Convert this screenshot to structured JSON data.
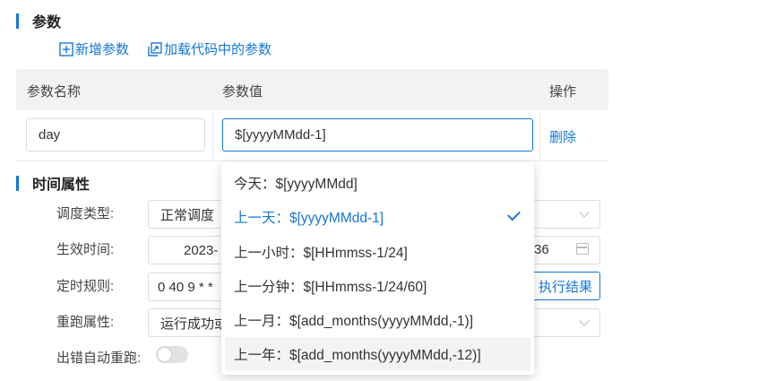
{
  "params_section": {
    "title": "参数",
    "add_param_label": "新增参数",
    "load_params_label": "加载代码中的参数"
  },
  "params_table": {
    "headers": [
      "参数名称",
      "参数值",
      "操作"
    ],
    "rows": [
      {
        "name": "day",
        "value": "$[yyyyMMdd-1]",
        "action": "删除"
      }
    ]
  },
  "dropdown": {
    "options": [
      {
        "label": "今天：$[yyyyMMdd]",
        "selected": false
      },
      {
        "label": "上一天：$[yyyyMMdd-1]",
        "selected": true
      },
      {
        "label": "上一小时：$[HHmmss-1/24]",
        "selected": false
      },
      {
        "label": "上一分钟：$[HHmmss-1/24/60]",
        "selected": false
      },
      {
        "label": "上一月：$[add_months(yyyyMMdd,-1)]",
        "selected": false
      },
      {
        "label": "上一年：$[add_months(yyyyMMdd,-12)]",
        "selected": false,
        "hovered": true
      }
    ]
  },
  "time_section": {
    "title": "时间属性",
    "schedule_type": {
      "label": "调度类型:",
      "value": "正常调度"
    },
    "effective_time": {
      "label": "生效时间:",
      "start_value": "2023-",
      "end_value": "36"
    },
    "cron_rule": {
      "label": "定时规则:",
      "value": "0 40 9 * *",
      "result_button": "执行结果"
    },
    "rerun_attr": {
      "label": "重跑属性:",
      "value": "运行成功或"
    },
    "auto_rerun": {
      "label": "出错自动重跑:",
      "enabled": false
    }
  },
  "colors": {
    "accent": "#1677d7",
    "header_bg": "#f2f2f2",
    "hover_bg": "#f3f3f3"
  }
}
